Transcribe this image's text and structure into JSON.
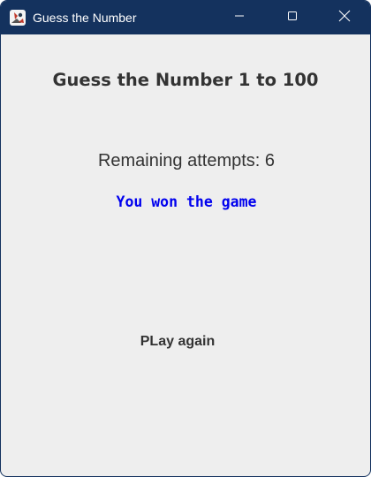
{
  "window": {
    "title": "Guess the Number",
    "titlebar_color": "#14325e",
    "background_color": "#eeeeee",
    "icons": {
      "app": "java-app-icon",
      "minimize": "minimize-icon",
      "maximize": "maximize-icon",
      "close": "close-icon"
    }
  },
  "game": {
    "heading": "Guess the Number 1 to 100",
    "attempts_text": "Remaining attempts: 6",
    "result_text": "You won the game",
    "result_color": "#0000ee",
    "play_again_label": "PLay again"
  }
}
